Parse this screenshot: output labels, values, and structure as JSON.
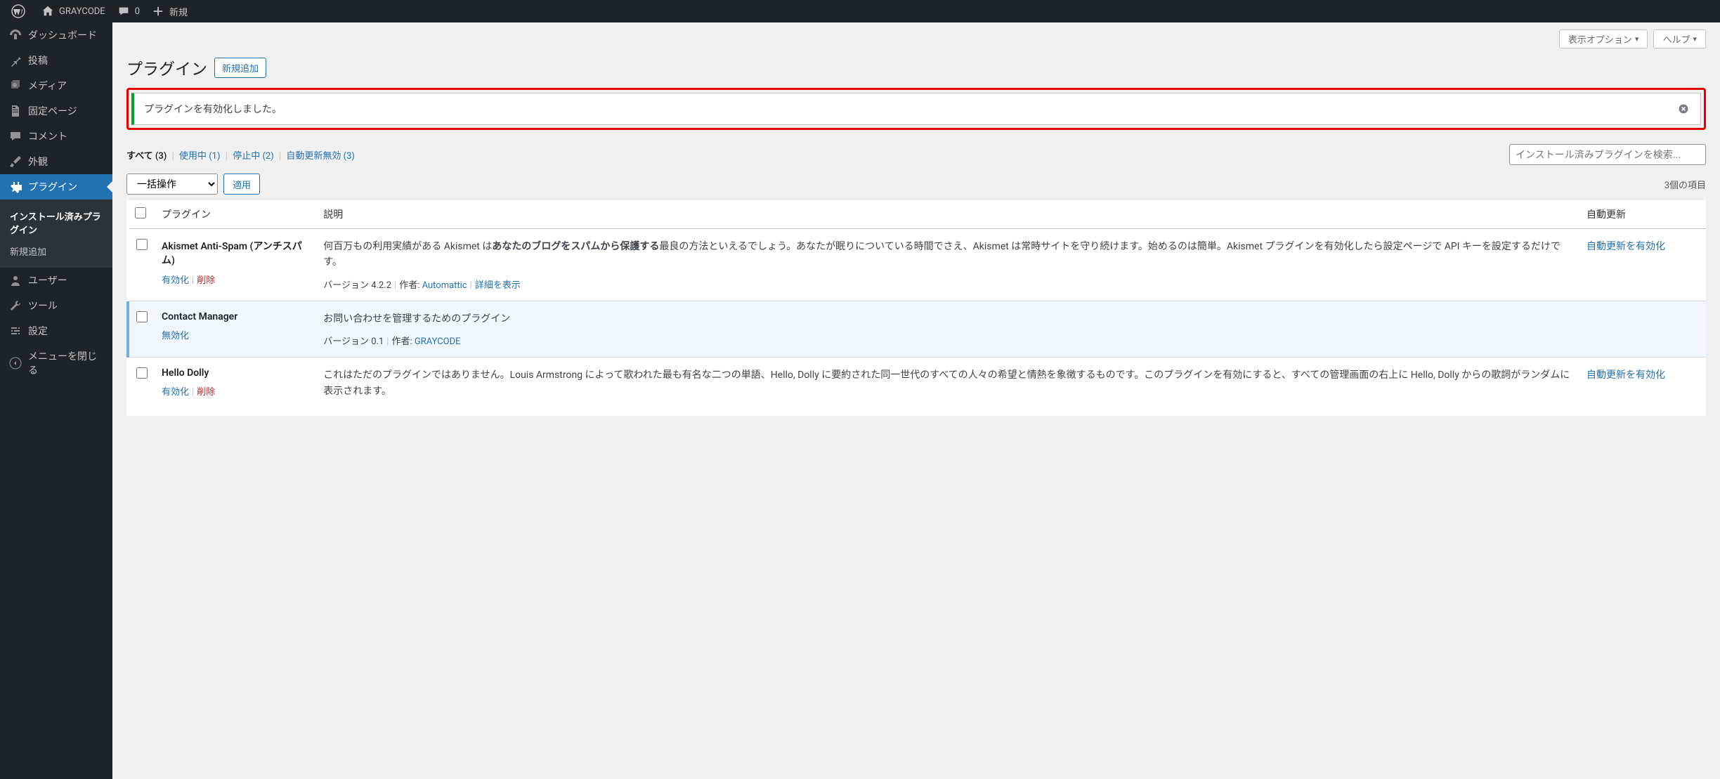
{
  "adminbar": {
    "site_name": "GRAYCODE",
    "comments_count": "0",
    "new_label": "新規"
  },
  "sidebar": {
    "items": [
      {
        "id": "dashboard",
        "label": "ダッシュボード"
      },
      {
        "id": "posts",
        "label": "投稿"
      },
      {
        "id": "media",
        "label": "メディア"
      },
      {
        "id": "pages",
        "label": "固定ページ"
      },
      {
        "id": "comments",
        "label": "コメント"
      },
      {
        "id": "appearance",
        "label": "外観"
      },
      {
        "id": "plugins",
        "label": "プラグイン"
      },
      {
        "id": "users",
        "label": "ユーザー"
      },
      {
        "id": "tools",
        "label": "ツール"
      },
      {
        "id": "settings",
        "label": "設定"
      }
    ],
    "submenu": {
      "installed": "インストール済みプラグイン",
      "add_new": "新規追加"
    },
    "collapse": "メニューを閉じる"
  },
  "screen": {
    "options": "表示オプション",
    "help": "ヘルプ"
  },
  "page": {
    "title": "プラグイン",
    "add_new": "新規追加"
  },
  "notice": {
    "message": "プラグインを有効化しました。"
  },
  "filters": {
    "all_label": "すべて",
    "all_count": "(3)",
    "active_label": "使用中",
    "active_count": "(1)",
    "inactive_label": "停止中",
    "inactive_count": "(2)",
    "autoupdate_label": "自動更新無効",
    "autoupdate_count": "(3)"
  },
  "search": {
    "placeholder": "インストール済みプラグインを検索..."
  },
  "bulk": {
    "select": "一括操作",
    "apply": "適用"
  },
  "pagination": {
    "count": "3個の項目"
  },
  "columns": {
    "plugin": "プラグイン",
    "description": "説明",
    "auto_update": "自動更新"
  },
  "actions": {
    "activate": "有効化",
    "deactivate": "無効化",
    "delete": "削除",
    "enable_auto": "自動更新を有効化",
    "version_prefix": "バージョン",
    "author_prefix": "作者:",
    "details": "詳細を表示"
  },
  "plugins": [
    {
      "name": "Akismet Anti-Spam (アンチスパム)",
      "active": false,
      "desc_pre": "何百万もの利用実績がある Akismet は",
      "desc_strong": "あなたのブログをスパムから保護する",
      "desc_post": "最良の方法といえるでしょう。あなたが眠りについている時間でさえ、Akismet は常時サイトを守り続けます。始めるのは簡単。Akismet プラグインを有効化したら設定ページで API キーを設定するだけです。",
      "version": "4.2.2",
      "author": "Automattic",
      "has_details": true,
      "has_auto_update": true
    },
    {
      "name": "Contact Manager",
      "active": true,
      "desc_pre": "お問い合わせを管理するためのプラグイン",
      "desc_strong": "",
      "desc_post": "",
      "version": "0.1",
      "author": "GRAYCODE",
      "has_details": false,
      "has_auto_update": false
    },
    {
      "name": "Hello Dolly",
      "active": false,
      "desc_pre": "これはただのプラグインではありません。Louis Armstrong によって歌われた最も有名な二つの単語、Hello, Dolly に要約された同一世代のすべての人々の希望と情熱を象徴するものです。このプラグインを有効にすると、すべての管理画面の右上に Hello, Dolly からの歌詞がランダムに表示されます。",
      "desc_strong": "",
      "desc_post": "",
      "version": "",
      "author": "",
      "has_details": false,
      "has_auto_update": true
    }
  ]
}
